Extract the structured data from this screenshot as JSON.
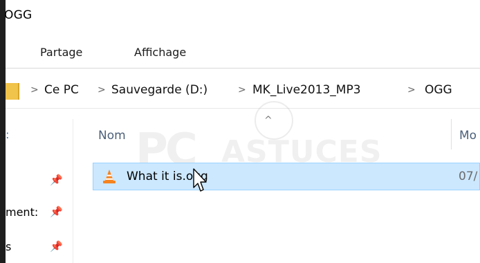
{
  "window": {
    "title": "OGG"
  },
  "ribbon": {
    "tabs": [
      {
        "label": "Partage"
      },
      {
        "label": "Affichage"
      }
    ]
  },
  "address": {
    "crumbs": [
      {
        "label": "Ce PC"
      },
      {
        "label": "Sauvegarde (D:)"
      },
      {
        "label": "MK_Live2013_MP3"
      },
      {
        "label": "OGG"
      }
    ],
    "separator": ">"
  },
  "nav": {
    "items": [
      {
        "label": ":"
      },
      {
        "label": "ment:"
      },
      {
        "label": "s"
      }
    ],
    "pin_icon": "pin-icon"
  },
  "list": {
    "columns": {
      "name": "Nom",
      "modified": "Mo"
    },
    "sort_indicator": "^",
    "rows": [
      {
        "name": "What it is.ogg",
        "date": "07/",
        "icon": "vlc-cone-icon",
        "selected": true
      }
    ]
  },
  "watermark": {
    "text_pc": "PC",
    "text_astuces": "ASTUCES"
  },
  "colors": {
    "selection_bg": "#cce8ff",
    "selection_border": "#99d1ff",
    "header_text": "#4c607a",
    "folder": "#f0c34a",
    "vlc_orange": "#f5831f"
  }
}
